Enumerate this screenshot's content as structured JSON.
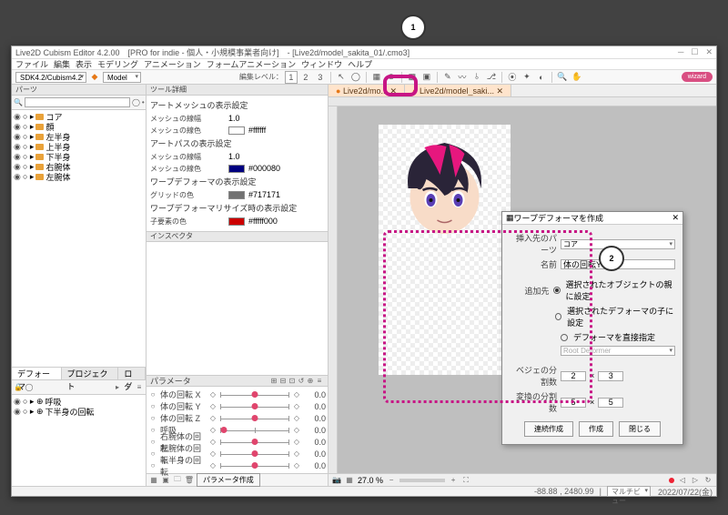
{
  "callouts": {
    "one": "1",
    "two": "2"
  },
  "title": "Live2D Cubism Editor 4.2.00　[PRO for indie - 個人・小規模事業者向け]　- [Live2d/model_sakita_01/.cmo3]",
  "menu": [
    "ファイル",
    "編集",
    "表示",
    "モデリング",
    "アニメーション",
    "フォームアニメーション",
    "ウィンドウ",
    "ヘルプ"
  ],
  "toolbar": {
    "project": "SDK4.2/Cubism4.2",
    "model_label": "Model",
    "edit_level_label": "編集レベル：",
    "edit_level": "1",
    "badge": "wizard"
  },
  "parts": {
    "header": "パーツ",
    "search_placeholder": "",
    "items": [
      "コア",
      "顔",
      "左半身",
      "上半身",
      "下半身",
      "右腕体",
      "左腕体"
    ]
  },
  "deformer": {
    "tabs": [
      "デフォーマ",
      "プロジェクト",
      "ログ"
    ],
    "items": [
      "呼吸",
      "下半身の回転"
    ]
  },
  "tool_detail": {
    "header": "ツール詳細",
    "section1": "アートメッシュの表示設定",
    "mesh_width_label": "メッシュの線幅",
    "mesh_width": "1.0",
    "mesh_color_label": "メッシュの線色",
    "mesh_color_val": "#ffffff",
    "section2": "アートパスの表示設定",
    "path_width_label": "メッシュの線幅",
    "path_width": "1.0",
    "path_color_label": "メッシュの線色",
    "path_color_val": "#000080",
    "section3": "ワープデフォーマの表示設定",
    "grid_color_label": "グリッドの色",
    "grid_color_val": "#717171",
    "section4": "ワープデフォーマリサイズ時の表示設定",
    "child_color_label": "子要素の色",
    "child_color_val": "#fffff000"
  },
  "inspector": {
    "header": "インスペクタ"
  },
  "params": {
    "header": "パラメータ",
    "items": [
      {
        "name": "体の回転 X",
        "val": "0.0",
        "pos": 50
      },
      {
        "name": "体の回転 Y",
        "val": "0.0",
        "pos": 50
      },
      {
        "name": "体の回転 Z",
        "val": "0.0",
        "pos": 50
      },
      {
        "name": "呼吸",
        "val": "0.0",
        "pos": 5
      },
      {
        "name": "右腕体の回転",
        "val": "0.0",
        "pos": 50
      },
      {
        "name": "左腕体の回転",
        "val": "0.0",
        "pos": 50
      },
      {
        "name": "下半身の回転",
        "val": "0.0",
        "pos": 50
      }
    ],
    "footer_btn": "パラメータ作成"
  },
  "canvas": {
    "tab1": "Live2d/mo...",
    "tab2": "Live2d/model_saki...",
    "zoom": "27.0 %",
    "coords": "-88.88 , 2480.99",
    "view_mode": "マルチビュー"
  },
  "dialog": {
    "title": "ワープデフォーマを作成",
    "parent_label": "挿入先のパーツ",
    "parent_value": "コア",
    "name_label": "名前",
    "name_value": "体の回転Y",
    "add_label": "追加先",
    "radio1": "選択されたオブジェクトの親に設定",
    "radio2": "選択されたデフォーマの子に設定",
    "radio3": "デフォーマを直接指定",
    "direct_label": "Root Deformer",
    "bezier_label": "ベジェの分割数",
    "bezier_x": "2",
    "bezier_y": "3",
    "convert_label": "変換の分割数",
    "convert_x": "5",
    "convert_y": "5",
    "btn_continue": "連続作成",
    "btn_create": "作成",
    "btn_close": "閉じる"
  },
  "statusbar": {
    "date": "2022/07/22(金)"
  }
}
